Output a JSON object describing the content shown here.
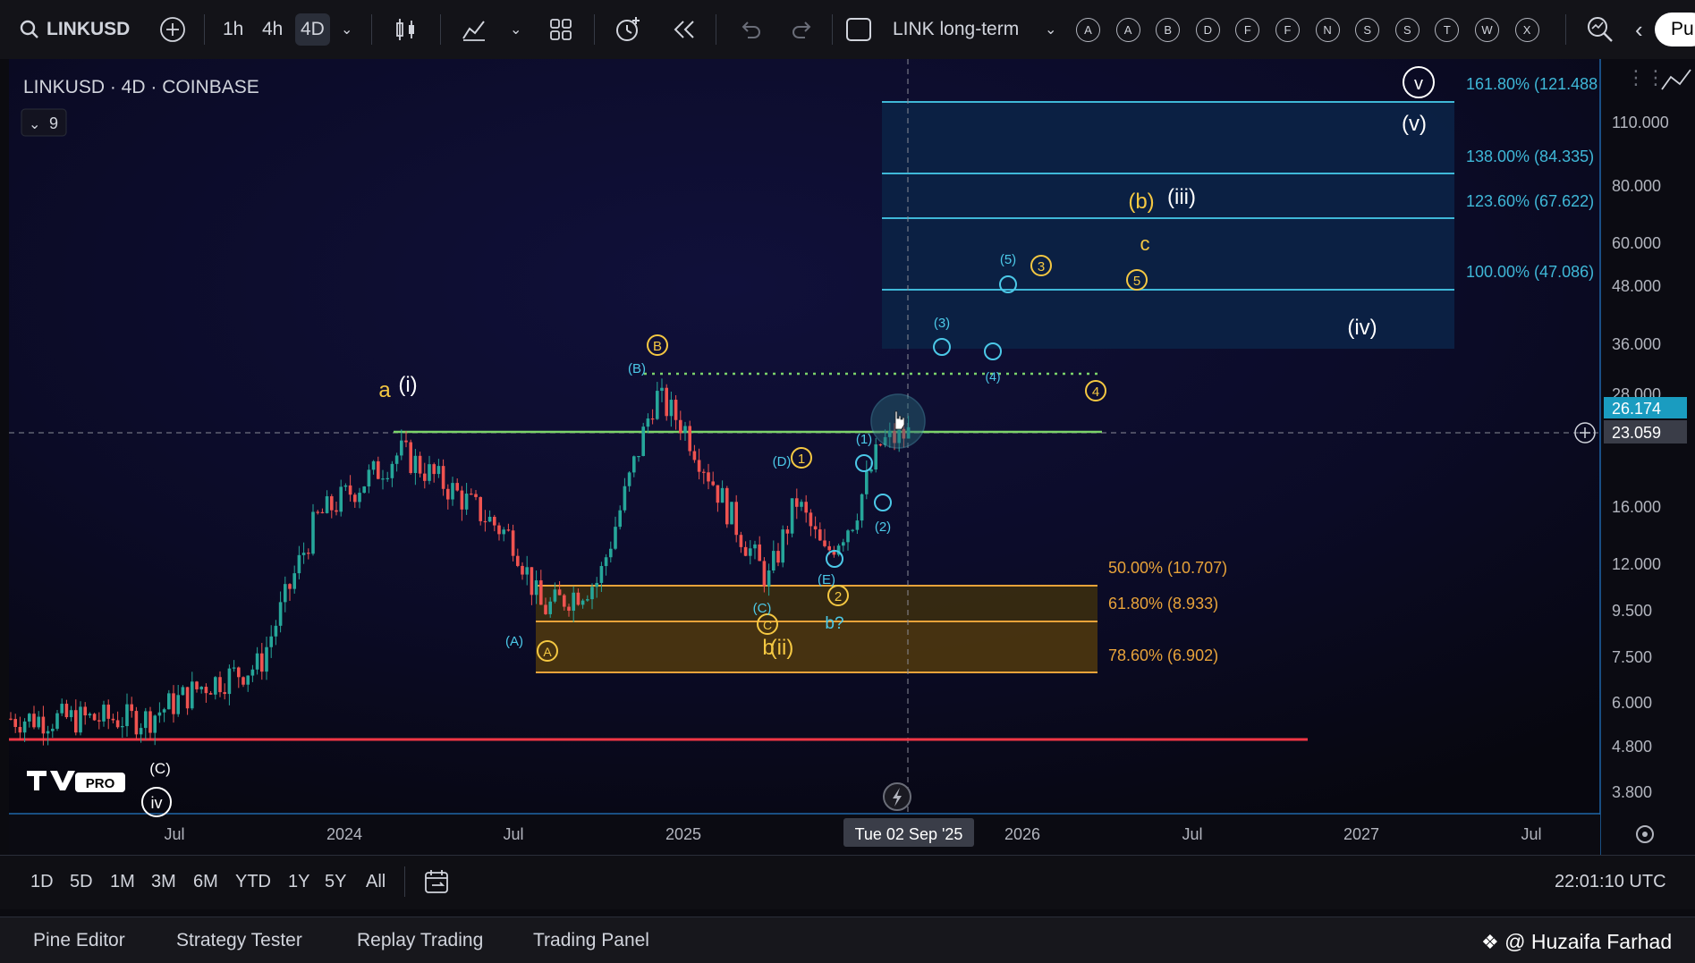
{
  "toolbar": {
    "symbol": "LINKUSD",
    "timeframes": [
      "1h",
      "4h",
      "4D"
    ],
    "active_timeframe": "4D",
    "layout_name": "LINK long-term",
    "alert_letters": [
      "A",
      "A",
      "B",
      "D",
      "F",
      "F",
      "N",
      "S",
      "S",
      "T",
      "W",
      "X"
    ],
    "publish_label": "Pu"
  },
  "chart": {
    "legend_title": "LINKUSD · 4D · COINBASE",
    "indicators_count": "9",
    "price_labels": [
      "110.000",
      "80.000",
      "60.000",
      "48.000",
      "36.000",
      "28.000",
      "16.000",
      "12.000",
      "9.500",
      "7.500",
      "6.000",
      "4.800",
      "3.800"
    ],
    "current_price": "26.174",
    "crosshair_price": "23.059",
    "time_labels": [
      "Jul",
      "2024",
      "Jul",
      "2025",
      "2026",
      "Jul",
      "2027",
      "Jul"
    ],
    "crosshair_time": "Tue 02 Sep '25",
    "fib_upper": [
      "161.80% (121.488",
      "138.00% (84.335)",
      "123.60% (67.622)",
      "100.00% (47.086)"
    ],
    "fib_lower": [
      "50.00% (10.707)",
      "61.80% (8.933)",
      "78.60% (6.902)"
    ],
    "wave_labels": {
      "v_circle": "v",
      "v_paren": "(v)",
      "b_paren": "(b)",
      "iii": "(iii)",
      "c": "c",
      "iv": "(iv)",
      "a": "a",
      "i": "(i)",
      "b_circle_top": "B",
      "B_paren": "(B)",
      "D_paren": "(D)",
      "one": "1",
      "three": "3",
      "five": "5",
      "two": "2",
      "four": "4",
      "p5": "(5)",
      "p3": "(3)",
      "p4": "(4)",
      "p1": "(1)",
      "p2": "(2)",
      "E_paren": "(E)",
      "C_paren": "(C)",
      "C_circle": "C",
      "b_q": "b?",
      "A_paren": "(A)",
      "A_circle": "A",
      "b_ii_b": "b",
      "b_ii": "(ii)",
      "bottom_C": "(C)",
      "bottom_iv": "iv"
    },
    "logo_text": "PRO"
  },
  "range_bar": {
    "ranges": [
      "1D",
      "5D",
      "1M",
      "3M",
      "6M",
      "YTD",
      "1Y",
      "5Y",
      "All"
    ],
    "clock": "22:01:10 UTC"
  },
  "bottom_tabs": [
    "Pine Editor",
    "Strategy Tester",
    "Replay Trading",
    "Trading Panel"
  ],
  "watermark": "@ Huzaifa Farhad",
  "chart_data": {
    "type": "candlestick",
    "title": "LINKUSD · 4D · COINBASE",
    "scale": "log",
    "ylim": [
      3.8,
      121.5
    ],
    "x_range": [
      "2023-06",
      "2027-09"
    ],
    "series": [
      {
        "name": "LINKUSD",
        "points_approx": [
          [
            "2023-06",
            5.5
          ],
          [
            "2023-08",
            6.5
          ],
          [
            "2023-10",
            7.2
          ],
          [
            "2023-12",
            15.0
          ],
          [
            "2024-03",
            21.0
          ],
          [
            "2024-05",
            17.0
          ],
          [
            "2024-07",
            13.5
          ],
          [
            "2024-08",
            9.5
          ],
          [
            "2024-10",
            11.0
          ],
          [
            "2024-12",
            28.0
          ],
          [
            "2025-01",
            24.0
          ],
          [
            "2025-03",
            14.0
          ],
          [
            "2025-04",
            11.0
          ],
          [
            "2025-05",
            16.5
          ],
          [
            "2025-06",
            12.5
          ],
          [
            "2025-07",
            15.0
          ],
          [
            "2025-08",
            22.0
          ],
          [
            "2025-09",
            23.06
          ]
        ]
      }
    ],
    "horizontal_lines": [
      23.06,
      4.9,
      27.9
    ],
    "fib_levels": {
      "161.80%": 121.488,
      "138.00%": 84.335,
      "123.60%": 67.622,
      "100.00%": 47.086,
      "50.00%": 10.707,
      "61.80%": 8.933,
      "78.60%": 6.902
    }
  }
}
